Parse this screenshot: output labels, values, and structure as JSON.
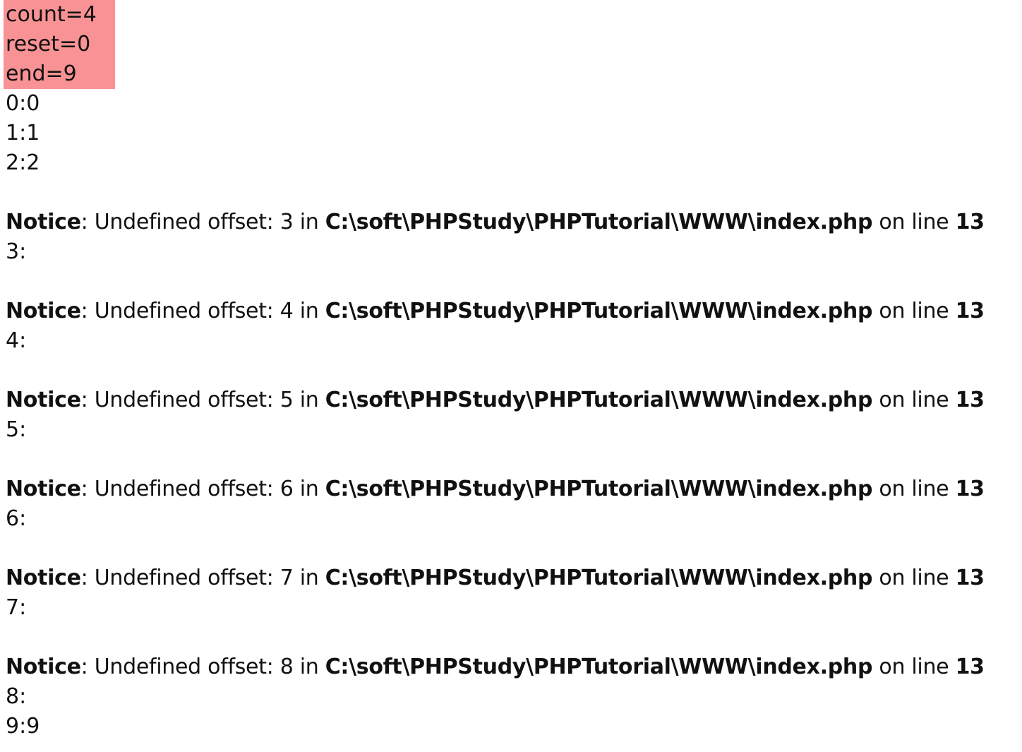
{
  "vars": [
    {
      "text": "count=4"
    },
    {
      "text": "reset=0"
    },
    {
      "text": "end=9"
    }
  ],
  "colors": {
    "highlight": "#f89294",
    "text": "#111111",
    "background": "#ffffff"
  },
  "rows_before": [
    "0:0",
    "1:1",
    "2:2"
  ],
  "notices": [
    {
      "label": "Notice",
      "message": ": Undefined offset: 3 in ",
      "file": "C:\\soft\\PHPStudy\\PHPTutorial\\WWW\\index.php",
      "on_line": " on line ",
      "line_no": "13",
      "row": "3:"
    },
    {
      "label": "Notice",
      "message": ": Undefined offset: 4 in ",
      "file": "C:\\soft\\PHPStudy\\PHPTutorial\\WWW\\index.php",
      "on_line": " on line ",
      "line_no": "13",
      "row": "4:"
    },
    {
      "label": "Notice",
      "message": ": Undefined offset: 5 in ",
      "file": "C:\\soft\\PHPStudy\\PHPTutorial\\WWW\\index.php",
      "on_line": " on line ",
      "line_no": "13",
      "row": "5:"
    },
    {
      "label": "Notice",
      "message": ": Undefined offset: 6 in ",
      "file": "C:\\soft\\PHPStudy\\PHPTutorial\\WWW\\index.php",
      "on_line": " on line ",
      "line_no": "13",
      "row": "6:"
    },
    {
      "label": "Notice",
      "message": ": Undefined offset: 7 in ",
      "file": "C:\\soft\\PHPStudy\\PHPTutorial\\WWW\\index.php",
      "on_line": " on line ",
      "line_no": "13",
      "row": "7:"
    },
    {
      "label": "Notice",
      "message": ": Undefined offset: 8 in ",
      "file": "C:\\soft\\PHPStudy\\PHPTutorial\\WWW\\index.php",
      "on_line": " on line ",
      "line_no": "13",
      "row": "8:"
    }
  ],
  "rows_after": [
    "9:9"
  ]
}
